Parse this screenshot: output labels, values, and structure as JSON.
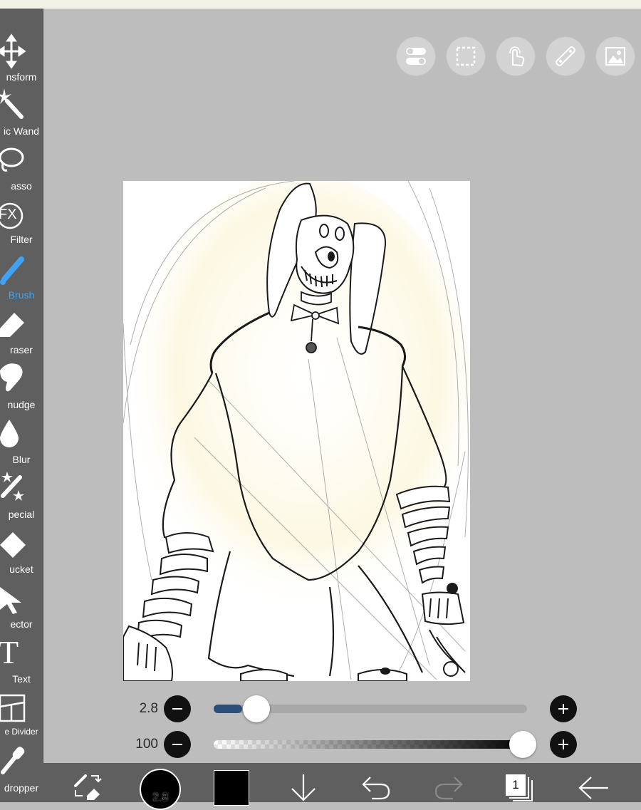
{
  "tools": [
    {
      "label": "nsform",
      "icon": "transform-icon"
    },
    {
      "label": "ic Wand",
      "icon": "magic-wand-icon"
    },
    {
      "label": "asso",
      "icon": "lasso-icon"
    },
    {
      "label": "Filter",
      "icon": "filter-fx-icon",
      "badge": "FX"
    },
    {
      "label": "Brush",
      "icon": "brush-icon",
      "active": true
    },
    {
      "label": "raser",
      "icon": "eraser-icon"
    },
    {
      "label": "nudge",
      "icon": "smudge-icon"
    },
    {
      "label": "Blur",
      "icon": "blur-drop-icon"
    },
    {
      "label": "pecial",
      "icon": "special-sparkle-icon"
    },
    {
      "label": "ucket",
      "icon": "bucket-icon"
    },
    {
      "label": "ector",
      "icon": "selector-arrow-icon"
    },
    {
      "label": "Text",
      "icon": "text-icon",
      "glyph": "T"
    },
    {
      "label": "e Divider",
      "icon": "frame-divider-icon"
    },
    {
      "label": "dropper",
      "icon": "eyedropper-icon"
    }
  ],
  "top_buttons": [
    "toggle-icon",
    "selection-icon",
    "touch-icon",
    "ruler-icon",
    "image-icon"
  ],
  "brush_size": {
    "value": "2.8",
    "fraction": 0.09
  },
  "opacity": {
    "value": "100",
    "fraction": 1.0
  },
  "bottom": {
    "brush_preview": "2.8",
    "layer_count": "1",
    "accent": "#3fa3f5",
    "color": "#000000"
  }
}
